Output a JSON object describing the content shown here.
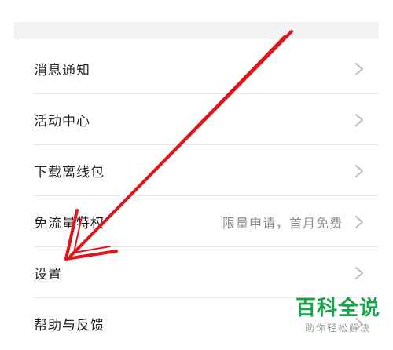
{
  "settings_menu": {
    "items": [
      {
        "label": "消息通知",
        "value": ""
      },
      {
        "label": "活动中心",
        "value": ""
      },
      {
        "label": "下载离线包",
        "value": ""
      },
      {
        "label": "免流量特权",
        "value": "限量申请，首月免费"
      },
      {
        "label": "设置",
        "value": ""
      },
      {
        "label": "帮助与反馈",
        "value": ""
      }
    ],
    "chevron_icon": "chevron-right-icon"
  },
  "annotation": {
    "type": "arrow",
    "color": "#e0141b",
    "target": "设置"
  },
  "watermark": {
    "brand": "百科全说",
    "tagline": "助你轻松解决",
    "color": "#1aa34a"
  }
}
